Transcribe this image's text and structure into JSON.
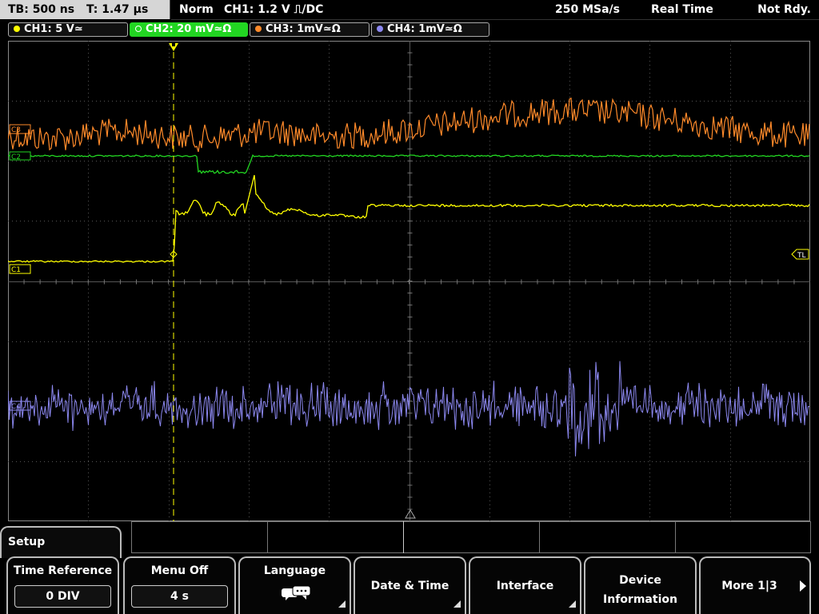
{
  "topbar": {
    "timebase": "TB: 500 ns",
    "trigger_time": "T: 1.47 µs",
    "trigger_mode": "Norm",
    "trigger_source": "CH1: 1.2 V ⎍/DC",
    "sample_rate": "250 MSa/s",
    "acq_mode": "Real Time",
    "status": "Not Rdy."
  },
  "channels": [
    {
      "label": "CH1: 5 V≃",
      "color": "#ffff00"
    },
    {
      "label": "CH2: 20 mV≃Ω",
      "color": "#22d622"
    },
    {
      "label": "CH3: 1mV≃Ω",
      "color": "#ff8a2a"
    },
    {
      "label": "CH4: 1mV≃Ω",
      "color": "#8c88f0"
    }
  ],
  "markers": {
    "ch1": "C1",
    "ch2": "C2",
    "ch3": "C3",
    "ch4": "C4",
    "trigger_level": "TL"
  },
  "menu": {
    "title": "Setup",
    "softkeys": [
      {
        "label": "Time Reference",
        "value": "0 DIV"
      },
      {
        "label": "Menu Off",
        "value": "4 s"
      },
      {
        "label": "Language",
        "icon": "speech-bubble-icon"
      },
      {
        "label": "Date & Time"
      },
      {
        "label": "Interface"
      },
      {
        "label": "Device",
        "label2": "Information"
      },
      {
        "label": "More 1|3"
      }
    ]
  }
}
